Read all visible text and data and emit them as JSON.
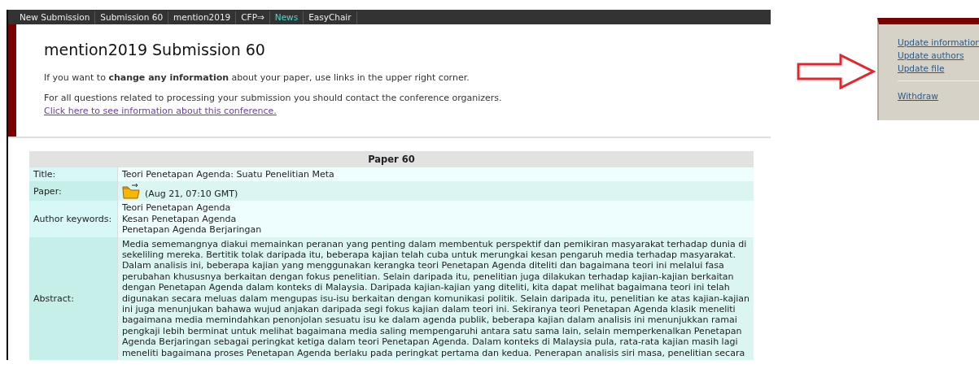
{
  "nav": {
    "tabs": [
      {
        "label": "New Submission",
        "selected": false
      },
      {
        "label": "Submission 60",
        "selected": false
      },
      {
        "label": "mention2019",
        "selected": false
      },
      {
        "label": "CFP⇒",
        "selected": false
      },
      {
        "label": "News",
        "selected": true
      },
      {
        "label": "EasyChair",
        "selected": false
      }
    ]
  },
  "header": {
    "title": "mention2019 Submission 60",
    "info": "If you want to **change any information** about your paper, use links in the upper right corner.",
    "contact": "For all questions related to processing your submission you should contact the conference organizers.",
    "contact_link": "Click here to see information about this conference."
  },
  "table": {
    "heading": "Paper 60",
    "rows": [
      {
        "kind": "text",
        "label": "Title:",
        "lines": [
          "Teori Penetapan Agenda: Suatu Penelitian Meta"
        ]
      },
      {
        "kind": "file",
        "label": "Paper:",
        "lines": [
          "(Aug 21, 07:10 GMT)"
        ]
      },
      {
        "kind": "text",
        "label": "Author keywords:",
        "lines": [
          "Teori Penetapan Agenda",
          "Kesan Penetapan Agenda",
          "Penetapan Agenda Berjaringan"
        ]
      },
      {
        "kind": "text",
        "label": "Abstract:",
        "lines": [
          "Media sememangnya diakui memainkan peranan yang penting dalam membentuk perspektif dan pemikiran masyarakat terhadap dunia di",
          "sekeliling mereka. Bertitik tolak daripada itu, beberapa kajian telah cuba untuk merungkai kesan pengaruh media terhadap masyarakat.",
          "Dalam analisis ini, beberapa kajian yang menggunakan kerangka teori Penetapan Agenda diteliti dan bagaimana teori ini melalui fasa",
          "perubahan khususnya berkaitan dengan fokus penelitian. Selain daripada itu, penelitian juga dilakukan terhadap kajian-kajian berkaitan",
          "dengan Penetapan Agenda dalam konteks di Malaysia. Daripada kajian-kajian yang diteliti, kita dapat melihat bagaimana teori ini telah",
          "digunakan secara meluas dalam mengupas isu-isu berkaitan dengan komunikasi politik. Selain daripada itu, penelitian ke atas kajian-kajian",
          "ini juga menunjukan bahawa wujud anjakan daripada segi fokus kajian dalam teori ini. Sekiranya teori Penetapan Agenda klasik meneliti",
          "bagaimana media memindahkan penonjolan sesuatu isu ke dalam agenda publik, beberapa kajian dalam analisis ini menunjukkan ramai",
          "pengkaji lebih berminat untuk melihat bagaimana media saling mempengaruhi antara satu sama lain, selain memperkenalkan Penetapan",
          "Agenda Berjaringan sebagai peringkat ketiga dalam teori Penetapan Agenda. Dalam konteks di Malaysia pula, rata-rata kajian masih lagi",
          "meneliti bagaimana proses Penetapan Agenda berlaku pada peringkat pertama dan kedua. Penerapan analisis siri masa, penelitian secara"
        ]
      }
    ]
  },
  "menu": {
    "groups": [
      [
        "Update information",
        "Update authors",
        "Update file"
      ],
      [
        "Withdraw"
      ]
    ]
  }
}
